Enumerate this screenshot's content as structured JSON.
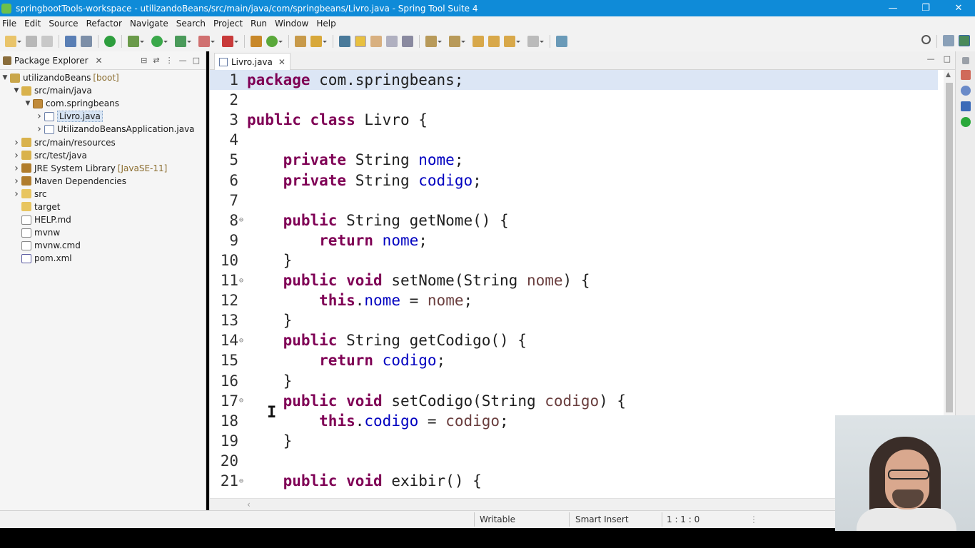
{
  "window": {
    "title": "springbootTools-workspace - utilizandoBeans/src/main/java/com/springbeans/Livro.java - Spring Tool Suite 4",
    "minimize": "—",
    "restore": "❐",
    "close": "✕"
  },
  "menu": [
    "File",
    "Edit",
    "Source",
    "Refactor",
    "Navigate",
    "Search",
    "Project",
    "Run",
    "Window",
    "Help"
  ],
  "package_explorer": {
    "title": "Package Explorer",
    "close": "✕",
    "tree": [
      {
        "label": "utilizandoBeans",
        "decor": "[boot]",
        "expanded": true,
        "indent": 0,
        "icon": "project-icon"
      },
      {
        "label": "src/main/java",
        "decor": "",
        "expanded": true,
        "indent": 1,
        "icon": "source-folder-icon"
      },
      {
        "label": "com.springbeans",
        "decor": "",
        "expanded": true,
        "indent": 2,
        "icon": "package-icon"
      },
      {
        "label": "Livro.java",
        "decor": "",
        "expanded": false,
        "indent": 3,
        "icon": "java-file-icon",
        "selected": true
      },
      {
        "label": "UtilizandoBeansApplication.java",
        "decor": "",
        "expanded": false,
        "indent": 3,
        "icon": "java-file-icon"
      },
      {
        "label": "src/main/resources",
        "decor": "",
        "expanded": false,
        "indent": 1,
        "icon": "source-folder-icon"
      },
      {
        "label": "src/test/java",
        "decor": "",
        "expanded": false,
        "indent": 1,
        "icon": "source-folder-icon"
      },
      {
        "label": "JRE System Library",
        "decor": "[JavaSE-11]",
        "expanded": false,
        "indent": 1,
        "icon": "library-icon"
      },
      {
        "label": "Maven Dependencies",
        "decor": "",
        "expanded": false,
        "indent": 1,
        "icon": "library-icon"
      },
      {
        "label": "src",
        "decor": "",
        "expanded": false,
        "indent": 1,
        "icon": "folder-icon"
      },
      {
        "label": "target",
        "decor": "",
        "expanded": null,
        "indent": 1,
        "icon": "folder-icon"
      },
      {
        "label": "HELP.md",
        "decor": "",
        "expanded": null,
        "indent": 1,
        "icon": "file-icon"
      },
      {
        "label": "mvnw",
        "decor": "",
        "expanded": null,
        "indent": 1,
        "icon": "file-icon"
      },
      {
        "label": "mvnw.cmd",
        "decor": "",
        "expanded": null,
        "indent": 1,
        "icon": "file-icon"
      },
      {
        "label": "pom.xml",
        "decor": "",
        "expanded": null,
        "indent": 1,
        "icon": "xml-file-icon"
      }
    ]
  },
  "editor": {
    "tab_label": "Livro.java",
    "tab_close": "✕",
    "lines": [
      {
        "n": "1",
        "fold": "",
        "tokens": [
          [
            "kw",
            "package"
          ],
          [
            "plain",
            " com.springbeans;"
          ]
        ]
      },
      {
        "n": "2",
        "fold": "",
        "tokens": []
      },
      {
        "n": "3",
        "fold": "",
        "tokens": [
          [
            "kw",
            "public"
          ],
          [
            "plain",
            " "
          ],
          [
            "kw",
            "class"
          ],
          [
            "plain",
            " Livro {"
          ]
        ]
      },
      {
        "n": "4",
        "fold": "",
        "tokens": []
      },
      {
        "n": "5",
        "fold": "",
        "tokens": [
          [
            "plain",
            "    "
          ],
          [
            "kw",
            "private"
          ],
          [
            "plain",
            " String "
          ],
          [
            "fld",
            "nome"
          ],
          [
            "plain",
            ";"
          ]
        ]
      },
      {
        "n": "6",
        "fold": "",
        "tokens": [
          [
            "plain",
            "    "
          ],
          [
            "kw",
            "private"
          ],
          [
            "plain",
            " String "
          ],
          [
            "fld",
            "codigo"
          ],
          [
            "plain",
            ";"
          ]
        ]
      },
      {
        "n": "7",
        "fold": "",
        "tokens": []
      },
      {
        "n": "8",
        "fold": "⊖",
        "tokens": [
          [
            "plain",
            "    "
          ],
          [
            "kw",
            "public"
          ],
          [
            "plain",
            " String getNome() {"
          ]
        ]
      },
      {
        "n": "9",
        "fold": "",
        "tokens": [
          [
            "plain",
            "        "
          ],
          [
            "kw",
            "return"
          ],
          [
            "plain",
            " "
          ],
          [
            "fld",
            "nome"
          ],
          [
            "plain",
            ";"
          ]
        ]
      },
      {
        "n": "10",
        "fold": "",
        "tokens": [
          [
            "plain",
            "    }"
          ]
        ]
      },
      {
        "n": "11",
        "fold": "⊖",
        "tokens": [
          [
            "plain",
            "    "
          ],
          [
            "kw",
            "public"
          ],
          [
            "plain",
            " "
          ],
          [
            "kw",
            "void"
          ],
          [
            "plain",
            " setNome(String "
          ],
          [
            "par",
            "nome"
          ],
          [
            "plain",
            ") {"
          ]
        ]
      },
      {
        "n": "12",
        "fold": "",
        "tokens": [
          [
            "plain",
            "        "
          ],
          [
            "kw",
            "this"
          ],
          [
            "plain",
            "."
          ],
          [
            "fld",
            "nome"
          ],
          [
            "plain",
            " = "
          ],
          [
            "par",
            "nome"
          ],
          [
            "plain",
            ";"
          ]
        ]
      },
      {
        "n": "13",
        "fold": "",
        "tokens": [
          [
            "plain",
            "    }"
          ]
        ]
      },
      {
        "n": "14",
        "fold": "⊖",
        "tokens": [
          [
            "plain",
            "    "
          ],
          [
            "kw",
            "public"
          ],
          [
            "plain",
            " String getCodigo() {"
          ]
        ]
      },
      {
        "n": "15",
        "fold": "",
        "tokens": [
          [
            "plain",
            "        "
          ],
          [
            "kw",
            "return"
          ],
          [
            "plain",
            " "
          ],
          [
            "fld",
            "codigo"
          ],
          [
            "plain",
            ";"
          ]
        ]
      },
      {
        "n": "16",
        "fold": "",
        "tokens": [
          [
            "plain",
            "    }"
          ]
        ]
      },
      {
        "n": "17",
        "fold": "⊖",
        "tokens": [
          [
            "plain",
            "    "
          ],
          [
            "kw",
            "public"
          ],
          [
            "plain",
            " "
          ],
          [
            "kw",
            "void"
          ],
          [
            "plain",
            " setCodigo(String "
          ],
          [
            "par",
            "codigo"
          ],
          [
            "plain",
            ") {"
          ]
        ]
      },
      {
        "n": "18",
        "fold": "",
        "tokens": [
          [
            "plain",
            "        "
          ],
          [
            "kw",
            "this"
          ],
          [
            "plain",
            "."
          ],
          [
            "fld",
            "codigo"
          ],
          [
            "plain",
            " = "
          ],
          [
            "par",
            "codigo"
          ],
          [
            "plain",
            ";"
          ]
        ]
      },
      {
        "n": "19",
        "fold": "",
        "tokens": [
          [
            "plain",
            "    }"
          ]
        ]
      },
      {
        "n": "20",
        "fold": "",
        "tokens": []
      },
      {
        "n": "21",
        "fold": "⊖",
        "tokens": [
          [
            "plain",
            "    "
          ],
          [
            "kw",
            "public"
          ],
          [
            "plain",
            " "
          ],
          [
            "kw",
            "void"
          ],
          [
            "plain",
            " exibir() {"
          ]
        ]
      }
    ]
  },
  "status": {
    "writable": "Writable",
    "insert_mode": "Smart Insert",
    "position": "1 : 1 : 0"
  },
  "colors": {
    "titlebar": "#0f8bd8",
    "keyword": "#7f0055",
    "field": "#0000c0",
    "parameter": "#6a3e3e",
    "current_line": "#dce6f5"
  }
}
